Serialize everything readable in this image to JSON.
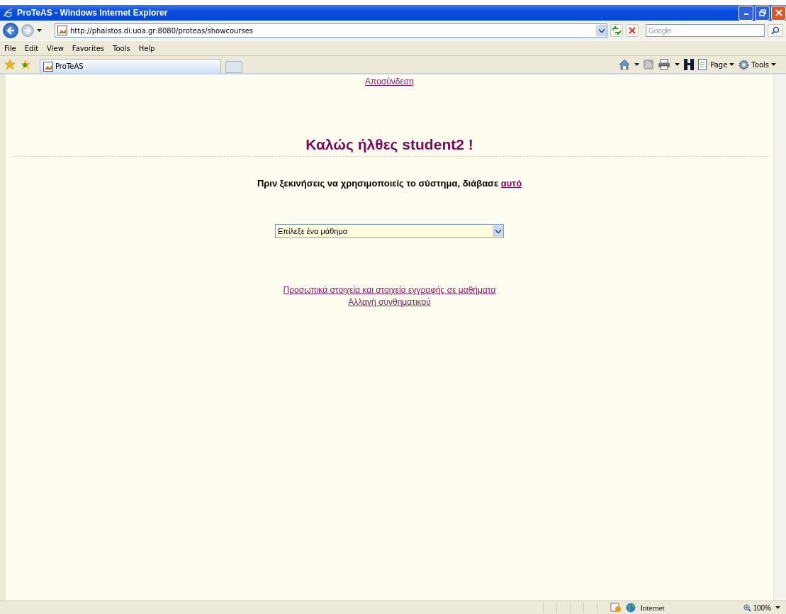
{
  "window": {
    "title": "ProTeAS - Windows Internet Explorer"
  },
  "address_bar": {
    "url": "http://phaistos.di.uoa.gr:8080/proteas/showcourses"
  },
  "search": {
    "placeholder": "Google"
  },
  "menu": [
    "File",
    "Edit",
    "View",
    "Favorites",
    "Tools",
    "Help"
  ],
  "tabs": [
    {
      "label": "ProTeAS",
      "selected": true
    }
  ],
  "command_bar": [
    "Page",
    "Tools"
  ],
  "page": {
    "logout_link": "Αποσύνδεση",
    "heading": "Καλώς ήλθες student2 !",
    "notice": {
      "text": "Πριν ξεκινήσεις να χρησιμοποιείς το σύστημα, διάβασε",
      "link": "αυτό"
    },
    "course_select": {
      "value": "Επίλεξε ένα μάθημα"
    },
    "links": [
      "Προσωπικά στοιχεία και στοιχεία εγγραφής σε μαθήματα",
      "Αλλαγή συνθηματικού"
    ]
  },
  "status_bar": {
    "zone": "Internet",
    "zoom": "100%"
  }
}
